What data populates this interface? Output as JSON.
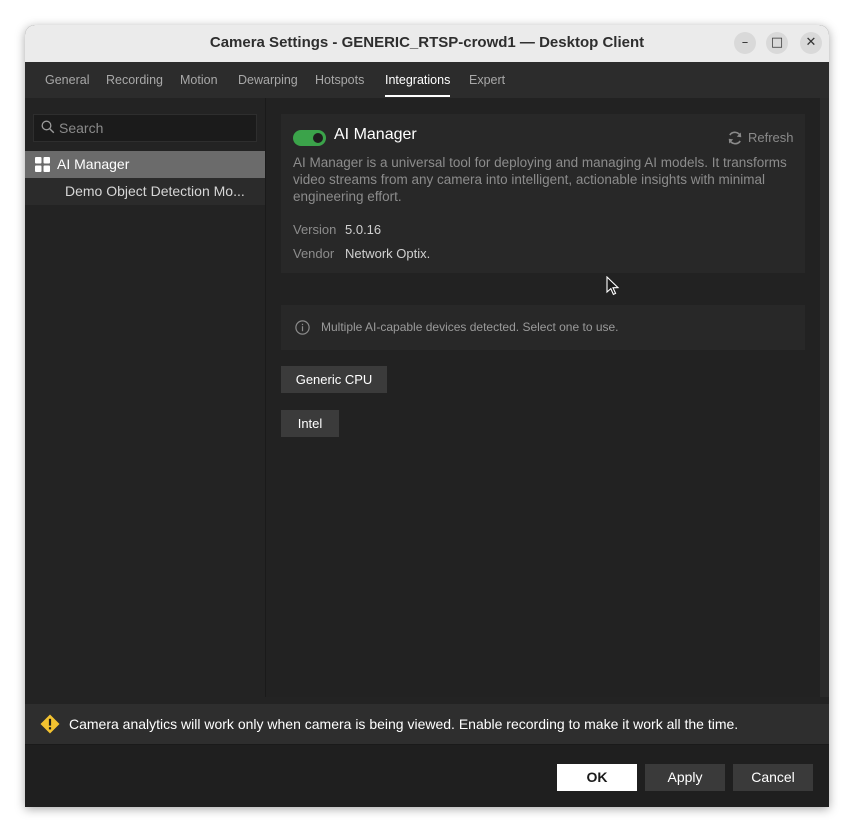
{
  "window": {
    "title": "Camera Settings - GENERIC_RTSP-crowd1 — Desktop Client",
    "controls": {
      "minimize": "–",
      "maximize": "□",
      "close": "✕"
    }
  },
  "tabs": [
    {
      "label": "General",
      "active": false
    },
    {
      "label": "Recording",
      "active": false
    },
    {
      "label": "Motion",
      "active": false
    },
    {
      "label": "Dewarping",
      "active": false
    },
    {
      "label": "Hotspots",
      "active": false
    },
    {
      "label": "Integrations",
      "active": true
    },
    {
      "label": "Expert",
      "active": false
    }
  ],
  "sidebar": {
    "search_placeholder": "Search",
    "search_icon": "search-icon",
    "items": [
      {
        "label": "AI Manager",
        "icon": "grid-icon",
        "selected": true
      },
      {
        "label": "Demo Object Detection Mo...",
        "selected": false
      }
    ]
  },
  "plugin": {
    "name": "AI Manager",
    "enabled": true,
    "toggle_color": "#3ba34a",
    "refresh_label": "Refresh",
    "description": "AI Manager is a universal tool for deploying and managing AI models. It transforms video streams from any camera into intelligent, actionable insights with minimal engineering effort.",
    "version_label": "Version",
    "version_value": "5.0.16",
    "vendor_label": "Vendor",
    "vendor_value": "Network Optix."
  },
  "info": {
    "icon": "info-icon",
    "message": "Multiple AI-capable devices detected. Select one to use."
  },
  "devices": [
    {
      "label": "Generic CPU"
    },
    {
      "label": "Intel"
    }
  ],
  "warning": {
    "icon": "warning-icon",
    "color": "#f2c230",
    "message": "Camera analytics will work only when camera is being viewed. Enable recording to make it work all the time."
  },
  "footer": {
    "ok_label": "OK",
    "apply_label": "Apply",
    "cancel_label": "Cancel"
  }
}
